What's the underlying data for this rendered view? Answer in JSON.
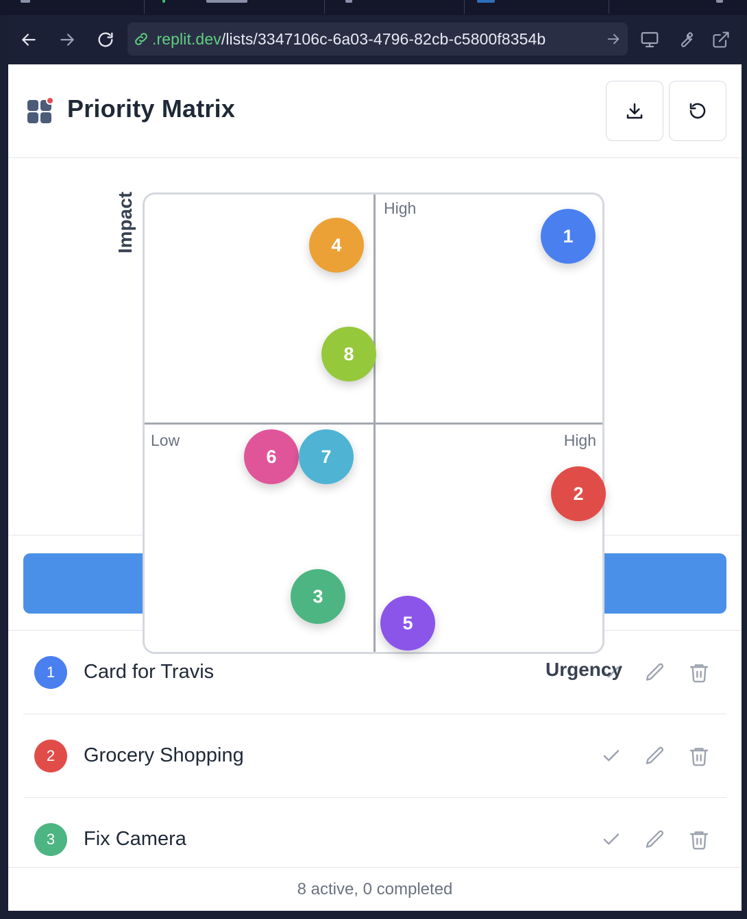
{
  "browser": {
    "url_host": ".replit.dev",
    "url_path": "/lists/3347106c-6a03-4796-82cb-c5800f8354b",
    "back_icon": "arrow-left-icon",
    "forward_icon": "arrow-right-icon",
    "reload_icon": "reload-icon",
    "link_icon": "link-icon",
    "go_icon": "arrow-right-icon",
    "devices_icon": "monitor-icon",
    "tools_icon": "wrench-icon",
    "open_external_icon": "external-link-icon"
  },
  "header": {
    "title": "Priority Matrix",
    "logo_icon": "grid-logo-icon",
    "download_icon": "download-icon",
    "reset_icon": "reset-icon"
  },
  "matrix": {
    "y_axis_label": "Impact",
    "x_axis_label": "Urgency",
    "quadrant_labels": {
      "top_right": "High",
      "bottom_left": "Low",
      "bottom_right": "High"
    },
    "dots": [
      {
        "number": "1",
        "color": "#4a7ff0"
      },
      {
        "number": "2",
        "color": "#e04d48"
      },
      {
        "number": "3",
        "color": "#4db582"
      },
      {
        "number": "4",
        "color": "#eba136"
      },
      {
        "number": "5",
        "color": "#8b55ea"
      },
      {
        "number": "6",
        "color": "#e0559a"
      },
      {
        "number": "7",
        "color": "#4fb3d4"
      },
      {
        "number": "8",
        "color": "#96c83c"
      }
    ]
  },
  "add_button": {
    "color": "#4a90e8"
  },
  "tasks": [
    {
      "number": "1",
      "title": "Card for Travis",
      "color": "#4a7ff0"
    },
    {
      "number": "2",
      "title": "Grocery Shopping",
      "color": "#e04d48"
    },
    {
      "number": "3",
      "title": "Fix Camera",
      "color": "#4db582"
    }
  ],
  "row_actions": {
    "complete_icon": "check-icon",
    "edit_icon": "pencil-icon",
    "delete_icon": "trash-icon"
  },
  "footer": {
    "summary": "8 active, 0 completed"
  }
}
